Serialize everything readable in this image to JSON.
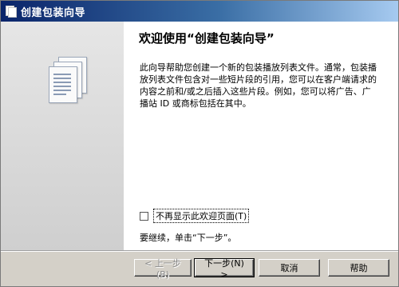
{
  "window": {
    "title": "创建包装向导"
  },
  "main": {
    "heading": "欢迎使用“创建包装向导”",
    "description": "此向导帮助您创建一个新的包装播放列表文件。通常，包装播放列表文件包含对一些短片段的引用，您可以在客户端请求的内容之前和/或之后插入这些片段。例如，您可以将广告、广播站 ID 或商标包括在其中。",
    "checkbox": {
      "label": "不再显示此欢迎页面(T)",
      "checked": false
    },
    "continue_text": "要继续，单击“下一步”。"
  },
  "buttons": {
    "back": "< 上一步(B)",
    "next": "下一步(N) >",
    "cancel": "取消",
    "help": "帮助"
  },
  "icons": {
    "title_icon": "wizard-app-icon",
    "illustration": "document-stack-icon"
  }
}
